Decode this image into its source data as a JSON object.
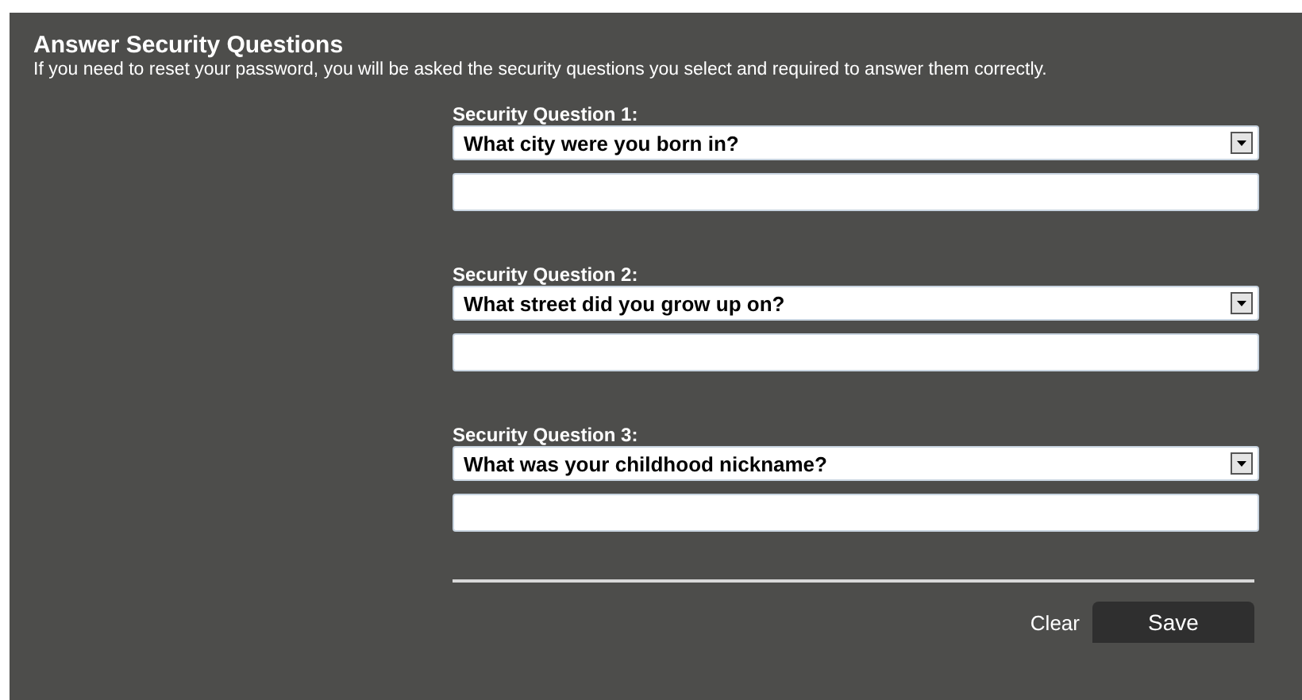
{
  "title": "Answer Security Questions",
  "description": "If you need to reset your password, you will be asked the security questions you select and required to answer them correctly.",
  "questions": [
    {
      "label": "Security Question 1:",
      "selected_question": "What city were you born in?"
    },
    {
      "label": "Security Question 2:",
      "selected_question": "What street did you grow up on?"
    },
    {
      "label": "Security Question 3:",
      "selected_question": "What was your childhood nickname?"
    }
  ],
  "buttons": {
    "clear": "Clear",
    "save": "Save"
  }
}
